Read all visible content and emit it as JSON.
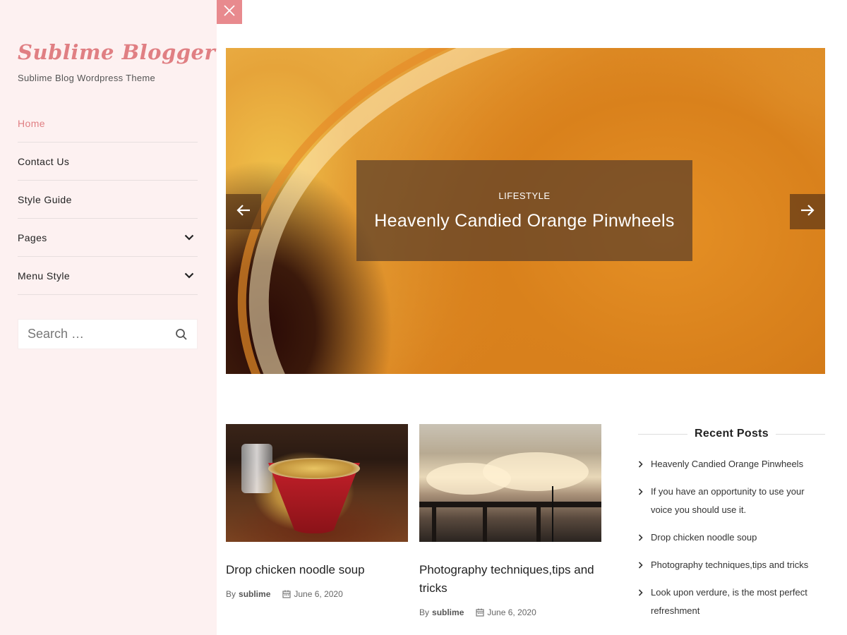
{
  "site": {
    "title": "Sublime Blogger",
    "tagline": "Sublime Blog Wordpress Theme"
  },
  "nav": {
    "items": [
      {
        "label": "Home",
        "active": true,
        "has_submenu": false
      },
      {
        "label": "Contact Us",
        "active": false,
        "has_submenu": false
      },
      {
        "label": "Style Guide",
        "active": false,
        "has_submenu": false
      },
      {
        "label": "Pages",
        "active": false,
        "has_submenu": true
      },
      {
        "label": "Menu Style",
        "active": false,
        "has_submenu": true
      }
    ]
  },
  "search": {
    "placeholder": "Search …",
    "value": "",
    "icon": "search-icon"
  },
  "close_button": {
    "icon": "close-icon"
  },
  "slider": {
    "category": "LIFESTYLE",
    "title": "Heavenly Candied Orange Pinwheels",
    "prev_icon": "arrow-left-icon",
    "next_icon": "arrow-right-icon"
  },
  "posts": [
    {
      "title": "Drop chicken noodle soup",
      "by": "By",
      "author": "sublime",
      "date": "June 6, 2020"
    },
    {
      "title": "Photography techniques,tips and tricks",
      "by": "By",
      "author": "sublime",
      "date": "June 6, 2020"
    }
  ],
  "recent_posts": {
    "title": "Recent Posts",
    "items": [
      "Heavenly Candied Orange Pinwheels",
      "If you have an opportunity to use your voice you should use it.",
      "Drop chicken noodle soup",
      "Photography techniques,tips and tricks",
      "Look upon verdure, is the most perfect refreshment"
    ]
  },
  "colors": {
    "accent": "#e07f83",
    "sidebar_bg": "#fdf1f1",
    "close_bg": "#e88a8e"
  }
}
